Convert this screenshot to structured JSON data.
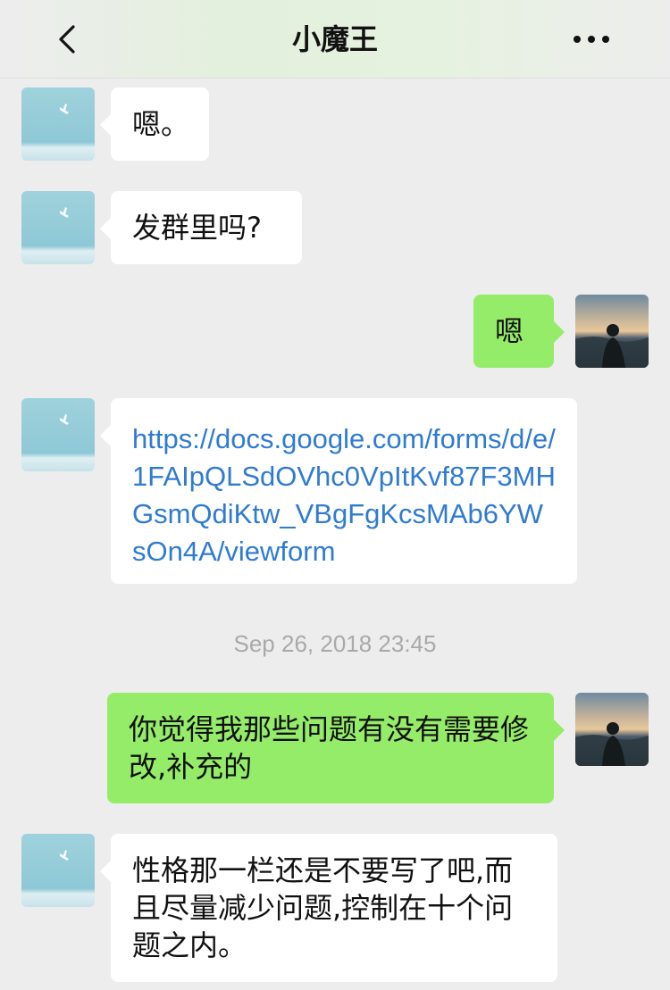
{
  "header": {
    "title": "小魔王",
    "back_icon": "chevron-left-icon",
    "more_icon": "more-dots-icon"
  },
  "messages": [
    {
      "side": "left",
      "text": "嗯。"
    },
    {
      "side": "left",
      "text": "发群里吗?"
    },
    {
      "side": "right",
      "text": "嗯"
    },
    {
      "side": "left",
      "text": "https://docs.google.com/forms/d/e/1FAIpQLSdOVhc0VpItKvf87F3MHGsmQdiKtw_VBgFgKcsMAb6YWsOn4A/viewform",
      "is_link": true
    },
    {
      "side": "right",
      "text": "你觉得我那些问题有没有需要修改,补充的"
    },
    {
      "side": "left",
      "text": "性格那一栏还是不要写了吧,而且尽量减少问题,控制在十个问题之内。"
    }
  ],
  "timestamp": "Sep 26, 2018 23:45",
  "colors": {
    "background": "#ededed",
    "bubble_left": "#ffffff",
    "bubble_right": "#95ec69",
    "link": "#2f7bd1",
    "timestamp": "#a9a9a9"
  }
}
